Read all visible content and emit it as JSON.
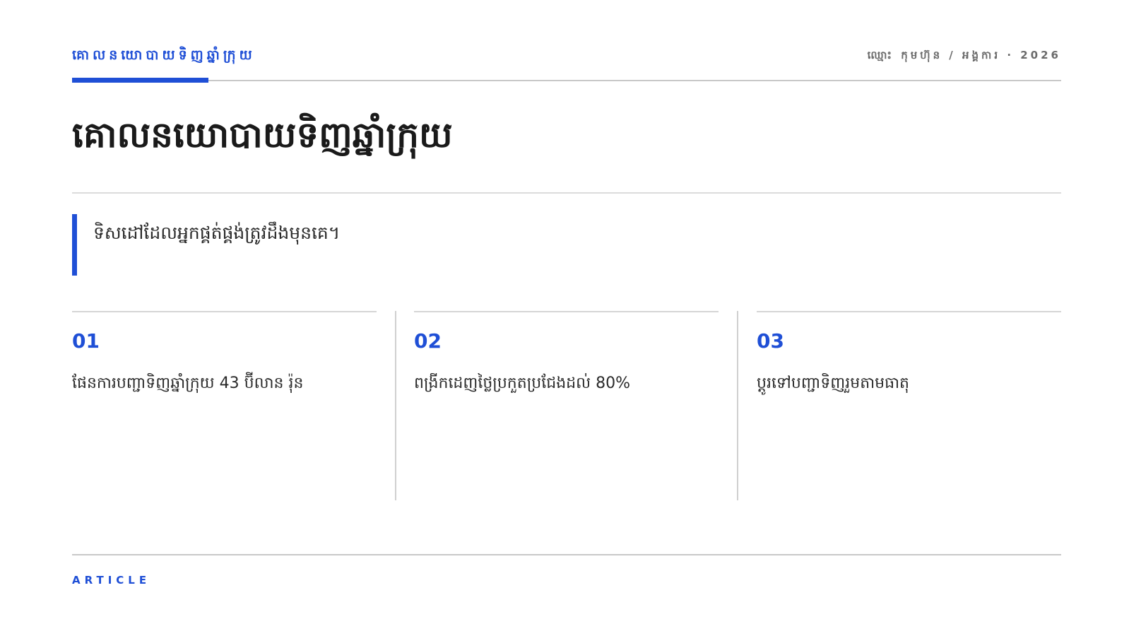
{
  "header": {
    "kicker": "គោលនយោបាយទិញឆ្នាំក្រុយ",
    "meta": "ឈ្មោះ កុមហ៊ុន / អង្គការ · 2026"
  },
  "title": "គោលនយោបាយទិញឆ្នាំក្រុយ",
  "lede": "ទិសដៅដែលអ្នកផ្គត់ផ្គង់ត្រូវដឹងមុនគេ។",
  "columns": [
    {
      "number": "01",
      "text": "ផែនការបញ្ជាទិញឆ្នាំក្រុយ 43 ប៊ីលាន រ៉ុន"
    },
    {
      "number": "02",
      "text": "ពង្រីកដេញថ្លៃប្រកួតប្រជែងដល់ 80%"
    },
    {
      "number": "03",
      "text": "ប្តូរទៅបញ្ជាទិញរួមតាមធាតុ"
    }
  ],
  "footer": {
    "label": "ARTICLE"
  },
  "colors": {
    "accent": "#1f4fd6",
    "text": "#1f1f1f",
    "muted": "#6b6b6b",
    "rule": "#c8c8c8"
  }
}
